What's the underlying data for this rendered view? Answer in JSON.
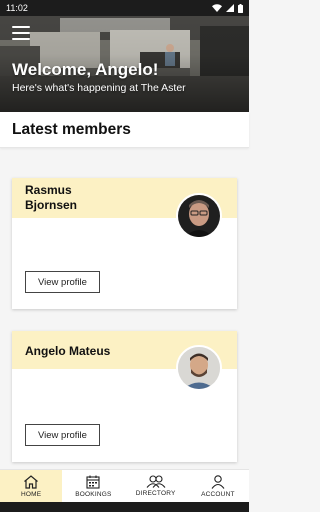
{
  "status_bar": {
    "time": "11:02"
  },
  "hero": {
    "title": "Welcome, Angelo!",
    "subtitle": "Here's what's happening at The Aster"
  },
  "section": {
    "title": "Latest members"
  },
  "members": [
    {
      "name_line1": "Rasmus",
      "name_line2": "Bjornsen",
      "button": "View profile"
    },
    {
      "name_line1": "Angelo Mateus",
      "name_line2": "",
      "button": "View profile"
    }
  ],
  "nav": {
    "items": [
      {
        "label": "HOME",
        "icon": "home-icon",
        "active": true
      },
      {
        "label": "BOOKINGS",
        "icon": "calendar-icon",
        "active": false
      },
      {
        "label": "DIRECTORY",
        "icon": "people-icon",
        "active": false
      },
      {
        "label": "ACCOUNT",
        "icon": "person-icon",
        "active": false
      }
    ]
  },
  "colors": {
    "accent": "#fcf1c4",
    "dark": "#1c1c1c"
  }
}
